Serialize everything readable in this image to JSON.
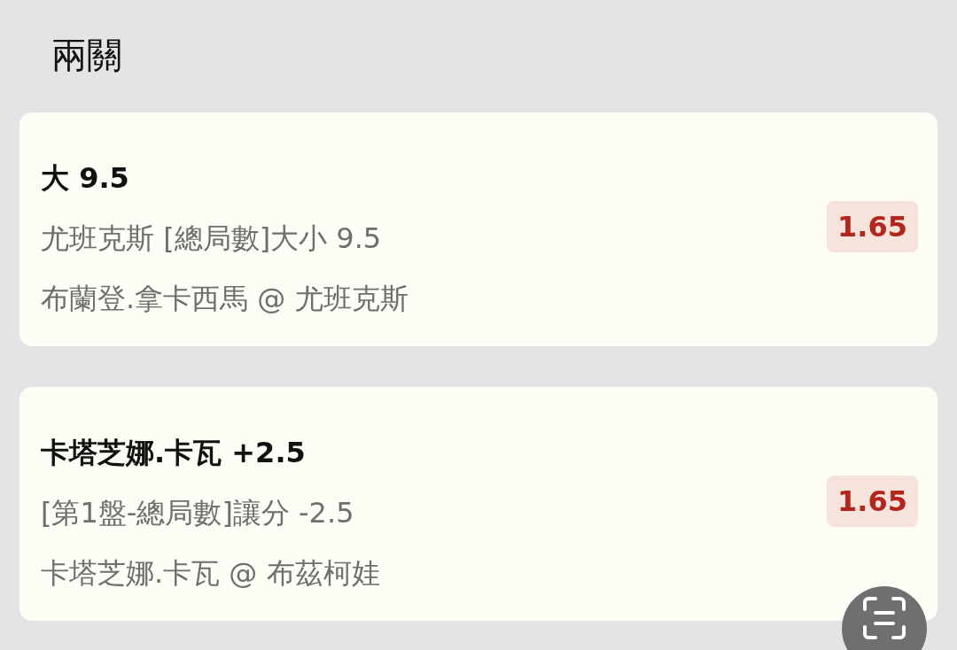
{
  "title": "兩關",
  "bets": [
    {
      "selection": "大 9.5",
      "market": "尤班克斯 [總局數]大小 9.5",
      "match": "布蘭登.拿卡西馬 @ 尤班克斯",
      "odds": "1.65"
    },
    {
      "selection": "卡塔芝娜.卡瓦 +2.5",
      "market": "[第1盤-總局數]讓分 -2.5",
      "match": "卡塔芝娜.卡瓦 @ 布茲柯娃",
      "odds": "1.65"
    }
  ]
}
